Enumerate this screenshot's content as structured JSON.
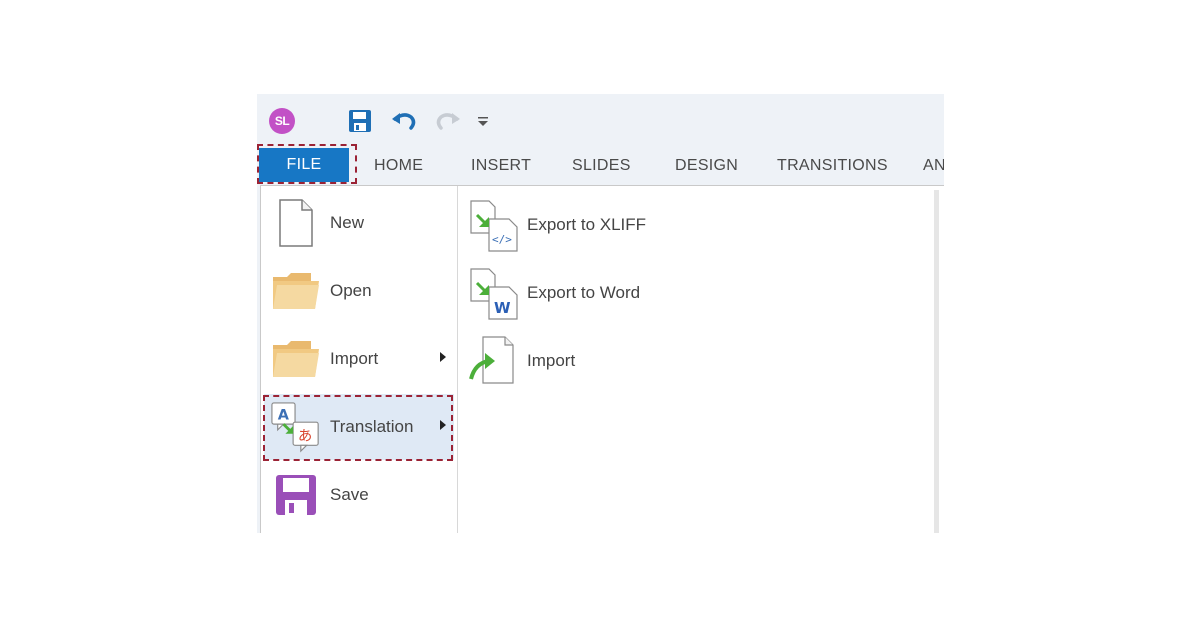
{
  "quick_access": {
    "logo_text": "SL",
    "save_icon": "save-icon",
    "undo_icon": "undo-icon",
    "redo_icon": "redo-icon",
    "more_icon": "customize-icon"
  },
  "tabs": [
    {
      "label": "FILE"
    },
    {
      "label": "HOME"
    },
    {
      "label": "INSERT"
    },
    {
      "label": "SLIDES"
    },
    {
      "label": "DESIGN"
    },
    {
      "label": "TRANSITIONS"
    },
    {
      "label": "AN"
    }
  ],
  "menu": {
    "new": "New",
    "open": "Open",
    "import": "Import",
    "translation": "Translation",
    "save": "Save"
  },
  "translation_submenu": {
    "export_xliff": "Export to XLIFF",
    "export_word": "Export to Word",
    "import": "Import"
  },
  "colors": {
    "file_tab": "#1777c5",
    "highlight_outline": "#9b2335",
    "selected_item": "#dfe9f5",
    "logo": "#c251c6",
    "arrow_green": "#4caf3a"
  }
}
